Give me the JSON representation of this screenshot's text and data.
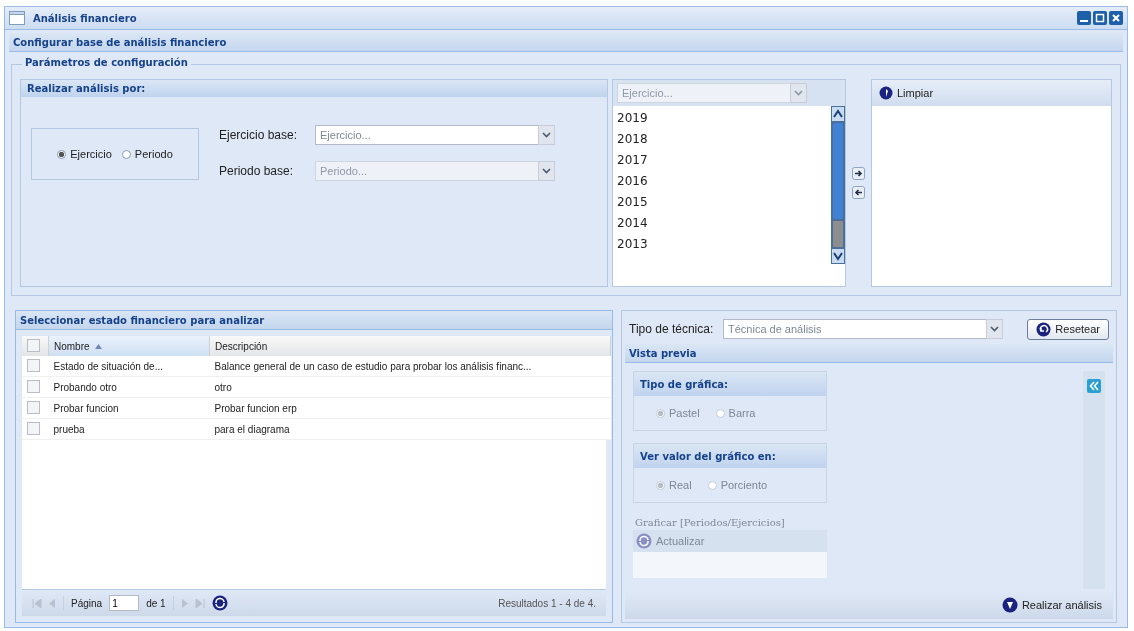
{
  "window": {
    "title": "Análisis financiero"
  },
  "config": {
    "title": "Configurar base de análisis financiero",
    "fieldset": "Parámetros de configuración",
    "analysis_by": {
      "title": "Realizar análisis por:",
      "options": [
        {
          "label": "Ejercicio",
          "selected": true
        },
        {
          "label": "Periodo",
          "selected": false
        }
      ],
      "fields": [
        {
          "label": "Ejercicio base:",
          "placeholder": "Ejercicio...",
          "disabled": false
        },
        {
          "label": "Periodo base:",
          "placeholder": "Periodo...",
          "disabled": true
        }
      ]
    },
    "available": {
      "placeholder": "Ejercicio...",
      "items": [
        "2019",
        "2018",
        "2017",
        "2016",
        "2015",
        "2014",
        "2013"
      ]
    },
    "chosen": {
      "clear_button": "Limpiar"
    }
  },
  "grid": {
    "title": "Seleccionar estado financiero para analizar",
    "all_checked": false,
    "columns": [
      {
        "label": "Nombre",
        "sorted": true
      },
      {
        "label": "Descripción",
        "sorted": false
      }
    ],
    "rows": [
      {
        "checked": false,
        "cells": [
          "Estado de situación de...",
          "Balance general de un caso de estudio para probar los análisis financ..."
        ]
      },
      {
        "checked": false,
        "cells": [
          "Probando otro",
          "otro"
        ]
      },
      {
        "checked": false,
        "cells": [
          "Probar funcion",
          "Probar funcion erp"
        ]
      },
      {
        "checked": false,
        "cells": [
          "prueba",
          "para el diagrama"
        ]
      }
    ],
    "paging": {
      "page_label": "Página",
      "page": "1",
      "of": "de 1",
      "results": "Resultados 1 - 4 de 4."
    }
  },
  "preview": {
    "technique_label": "Tipo de técnica:",
    "technique_placeholder": "Técnica de análisis",
    "reset_button": "Resetear",
    "title": "Vista previa",
    "groups": [
      {
        "title": "Tipo de gráfica:",
        "disabled": true,
        "options": [
          {
            "label": "Pastel",
            "selected": true
          },
          {
            "label": "Barra",
            "selected": false
          }
        ]
      },
      {
        "title": "Ver valor del gráfico en:",
        "disabled": true,
        "options": [
          {
            "label": "Real",
            "selected": true
          },
          {
            "label": "Porciento",
            "selected": false
          }
        ]
      }
    ],
    "plot": {
      "title": "Graficar [Periodos/Ejercicios]",
      "refresh_button": "Actualizar",
      "disabled": true
    },
    "run_button": "Realizar análisis"
  }
}
